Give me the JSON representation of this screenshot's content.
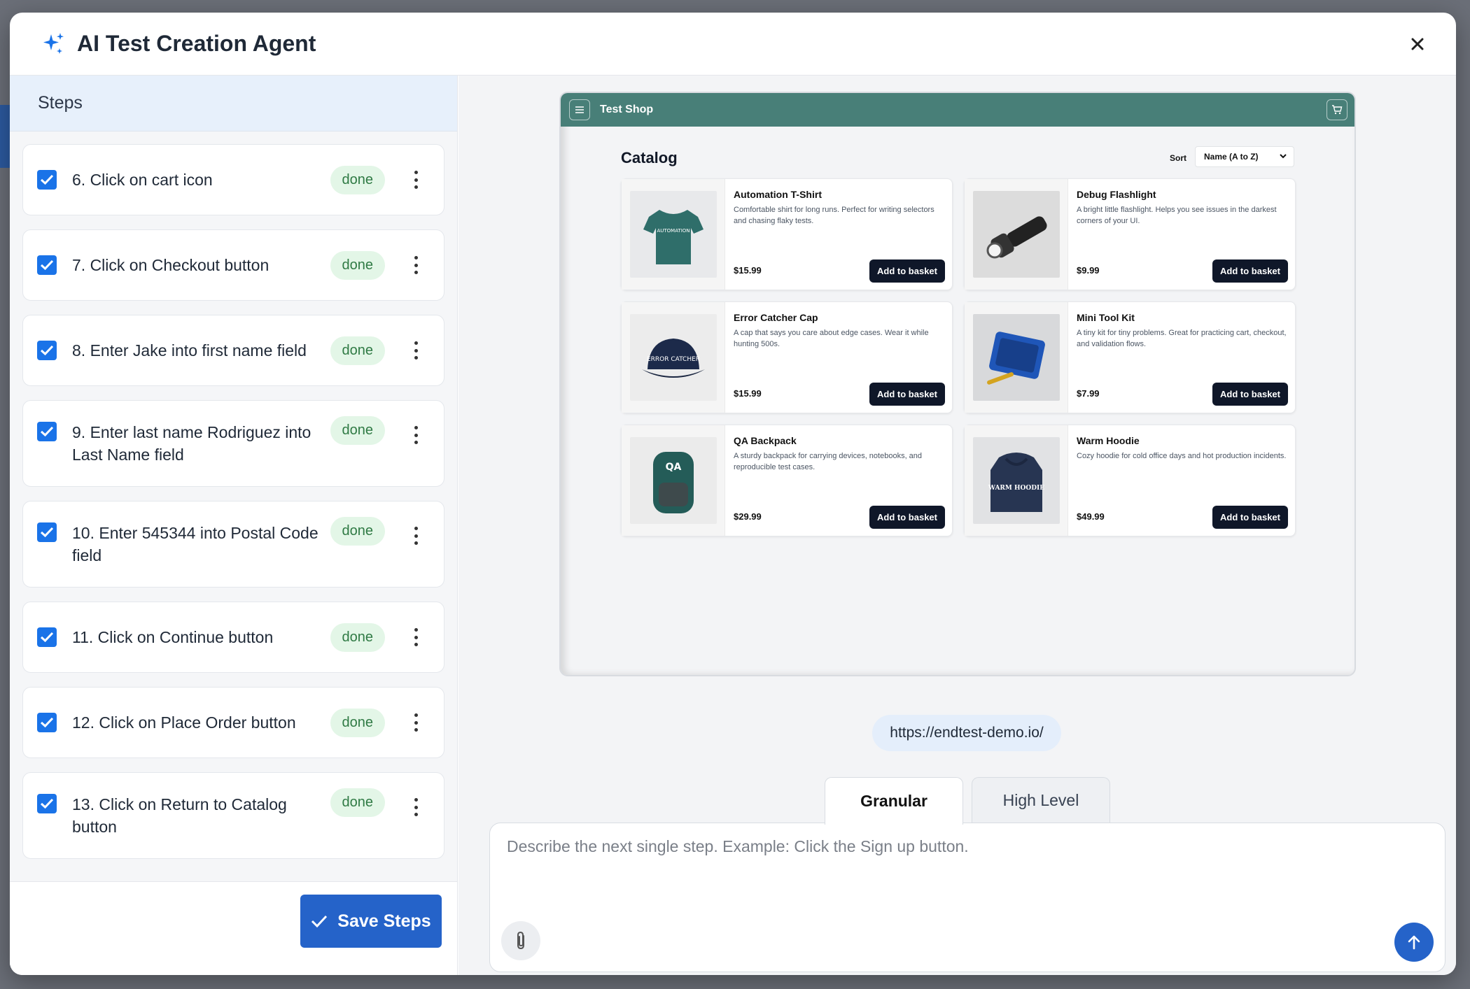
{
  "modal": {
    "title": "AI Test Creation Agent",
    "close_icon": "close-icon",
    "sparkle_icon": "sparkle-icon"
  },
  "steps_panel": {
    "header": "Steps",
    "items": [
      {
        "label": "6. Click on cart icon",
        "status": "done",
        "checked": true
      },
      {
        "label": "7. Click on Checkout button",
        "status": "done",
        "checked": true
      },
      {
        "label": "8. Enter Jake into first name field",
        "status": "done",
        "checked": true
      },
      {
        "label": "9. Enter last name Rodriguez into Last Name field",
        "status": "done",
        "checked": true
      },
      {
        "label": "10. Enter 545344 into Postal Code field",
        "status": "done",
        "checked": true
      },
      {
        "label": "11. Click on Continue button",
        "status": "done",
        "checked": true
      },
      {
        "label": "12. Click on Place Order button",
        "status": "done",
        "checked": true
      },
      {
        "label": "13. Click on Return to Catalog button",
        "status": "done",
        "checked": true
      }
    ],
    "save_label": "Save Steps"
  },
  "preview": {
    "shop_title": "Test Shop",
    "catalog_title": "Catalog",
    "sort_label": "Sort",
    "sort_value": "Name (A to Z)",
    "products": [
      {
        "name": "Automation T-Shirt",
        "desc": "Comfortable shirt for long runs. Perfect for writing selectors and chasing flaky tests.",
        "price": "$15.99",
        "button": "Add to basket",
        "image_text": "AUTOMATION"
      },
      {
        "name": "Debug Flashlight",
        "desc": "A bright little flashlight. Helps you see issues in the darkest corners of your UI.",
        "price": "$9.99",
        "button": "Add to basket",
        "image_text": ""
      },
      {
        "name": "Error Catcher Cap",
        "desc": "A cap that says you care about edge cases. Wear it while hunting 500s.",
        "price": "$15.99",
        "button": "Add to basket",
        "image_text": "ERROR CATCHER"
      },
      {
        "name": "Mini Tool Kit",
        "desc": "A tiny kit for tiny problems. Great for practicing cart, checkout, and validation flows.",
        "price": "$7.99",
        "button": "Add to basket",
        "image_text": ""
      },
      {
        "name": "QA Backpack",
        "desc": "A sturdy backpack for carrying devices, notebooks, and reproducible test cases.",
        "price": "$29.99",
        "button": "Add to basket",
        "image_text": "QA"
      },
      {
        "name": "Warm Hoodie",
        "desc": "Cozy hoodie for cold office days and hot production incidents.",
        "price": "$49.99",
        "button": "Add to basket",
        "image_text": "WARM HOODIE"
      }
    ]
  },
  "url": "https://endtest-demo.io/",
  "tabs": [
    {
      "label": "Granular",
      "active": true
    },
    {
      "label": "High Level",
      "active": false
    }
  ],
  "chat": {
    "placeholder": "Describe the next single step. Example: Click the Sign up button."
  },
  "colors": {
    "accent": "#2563c9",
    "shop_bar": "#487f78",
    "done_bg": "#e3f6e7",
    "done_text": "#2f7a44"
  }
}
